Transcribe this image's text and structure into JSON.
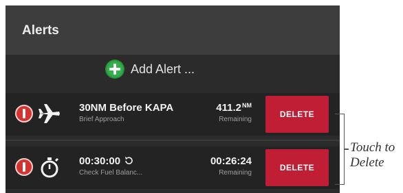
{
  "header": {
    "title": "Alerts"
  },
  "add_alert": {
    "label": "Add Alert ...",
    "icon": "plus-circle-icon",
    "icon_color": "#32b24a"
  },
  "alerts": [
    {
      "icon": "airplane-icon",
      "title": "30NM Before KAPA",
      "subtitle": "Brief Approach",
      "value": "411.2",
      "unit": "NM",
      "status": "Remaining",
      "delete_label": "DELETE"
    },
    {
      "icon": "stopwatch-icon",
      "title": "00:30:00",
      "repeat_icon": "repeat-icon",
      "subtitle": "Check Fuel Balanc...",
      "value": "00:26:24",
      "unit": "",
      "status": "Remaining",
      "delete_label": "DELETE"
    }
  ],
  "callout": {
    "line1": "Touch to",
    "line2": "Delete"
  },
  "colors": {
    "delete": "#bf1e35",
    "warning": "#d7332e",
    "panel": "#2b2b2b"
  }
}
